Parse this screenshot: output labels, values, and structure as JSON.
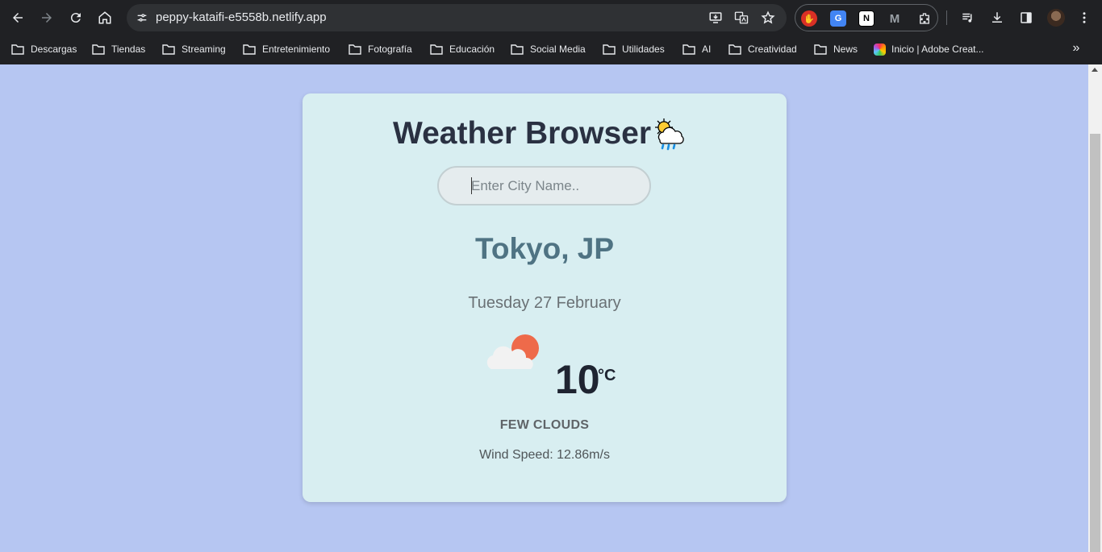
{
  "browser": {
    "url": "peppy-kataifi-e5558b.netlify.app",
    "bookmarks": [
      {
        "label": "Descargas"
      },
      {
        "label": "Tiendas"
      },
      {
        "label": "Streaming"
      },
      {
        "label": "Entretenimiento"
      },
      {
        "label": "Fotografía"
      },
      {
        "label": "Educación"
      },
      {
        "label": "Social Media"
      },
      {
        "label": "Utilidades"
      },
      {
        "label": "AI"
      },
      {
        "label": "Creatividad"
      },
      {
        "label": "News"
      },
      {
        "label": "Inicio | Adobe Creat..."
      }
    ],
    "bookmarks_more": "»"
  },
  "app": {
    "title": "Weather Browser",
    "title_emoji": "sun-behind-rain-cloud-icon",
    "search_placeholder": "Enter City Name..",
    "search_value": "",
    "city": "Tokyo, JP",
    "date": "Tuesday 27 February",
    "weather_icon": "few-clouds-icon",
    "temperature": "10",
    "unit": "°C",
    "description": "FEW CLOUDS",
    "wind_label": "Wind Speed:",
    "wind_value": "12.86m/s"
  },
  "colors": {
    "page_bg": "#b6c6f2",
    "card_bg": "#d8eef1",
    "city": "#4f7383",
    "title": "#2a3142",
    "sun": "#ee6a4a"
  }
}
